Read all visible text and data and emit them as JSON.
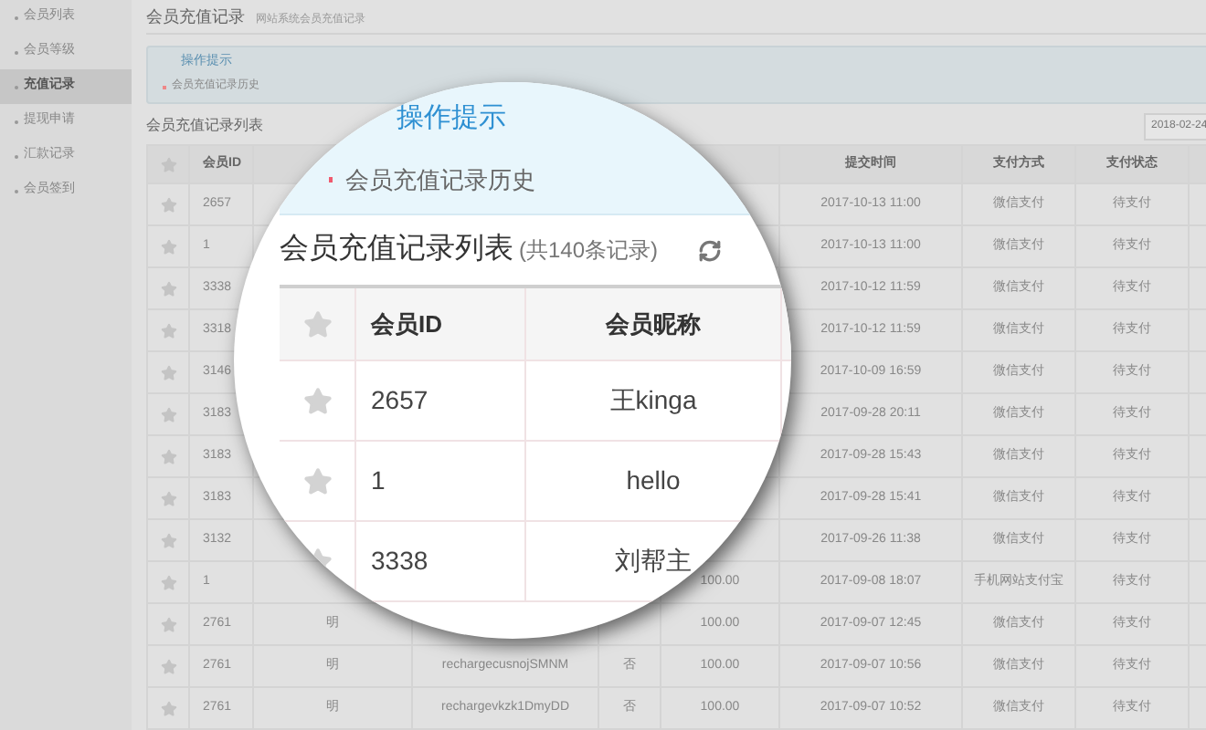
{
  "sidebar": {
    "items": [
      {
        "label": "会员列表",
        "selected": false
      },
      {
        "label": "会员等级",
        "selected": false
      },
      {
        "label": "充值记录",
        "selected": true
      },
      {
        "label": "提现申请",
        "selected": false
      },
      {
        "label": "汇款记录",
        "selected": false
      },
      {
        "label": "会员签到",
        "selected": false
      }
    ]
  },
  "page_header": {
    "title": "会员充值记录",
    "subtitle": "网站系统会员充值记录"
  },
  "tip": {
    "title": "操作提示",
    "item": "会员充值记录历史"
  },
  "list": {
    "title": "会员充值记录列表",
    "date": "2018-02-24"
  },
  "table": {
    "header": {
      "id": "会员ID",
      "time": "提交时间",
      "method": "支付方式",
      "status": "支付状态"
    },
    "rows": [
      {
        "id": "2657",
        "time": "2017-10-13 11:00",
        "method": "微信支付",
        "status": "待支付"
      },
      {
        "id": "1",
        "time": "2017-10-13 11:00",
        "method": "微信支付",
        "status": "待支付"
      },
      {
        "id": "3338",
        "time": "2017-10-12 11:59",
        "method": "微信支付",
        "status": "待支付"
      },
      {
        "id": "3318",
        "time": "2017-10-12 11:59",
        "method": "微信支付",
        "status": "待支付"
      },
      {
        "id": "3146",
        "time": "2017-10-09 16:59",
        "method": "微信支付",
        "status": "待支付"
      },
      {
        "id": "3183",
        "time": "2017-09-28 20:11",
        "method": "微信支付",
        "status": "待支付"
      },
      {
        "id": "3183",
        "time": "2017-09-28 15:43",
        "method": "微信支付",
        "status": "待支付"
      },
      {
        "id": "3183",
        "time": "2017-09-28 15:41",
        "method": "微信支付",
        "status": "待支付"
      },
      {
        "id": "3132",
        "time": "2017-09-26 11:38",
        "method": "微信支付",
        "status": "待支付"
      },
      {
        "id": "1",
        "amount": "100.00",
        "time": "2017-09-08 18:07",
        "method": "手机网站支付宝",
        "status": "待支付"
      },
      {
        "id": "2761",
        "nickname": "明",
        "amount": "100.00",
        "time": "2017-09-07 12:45",
        "method": "微信支付",
        "status": "待支付"
      },
      {
        "id": "2761",
        "nickname": "明",
        "order_no": "rechargecusnojSMNM",
        "flag": "否",
        "amount": "100.00",
        "time": "2017-09-07 10:56",
        "method": "微信支付",
        "status": "待支付"
      },
      {
        "id": "2761",
        "nickname": "明",
        "order_no": "rechargevkzk1DmyDD",
        "flag": "否",
        "amount": "100.00",
        "time": "2017-09-07 10:52",
        "method": "微信支付",
        "status": "待支付"
      }
    ]
  },
  "magnifier": {
    "tip_title": "操作提示",
    "tip_item": "会员充值记录历史",
    "list_title": "会员充值记录列表",
    "list_count": "(共140条记录)",
    "header": {
      "id": "会员ID",
      "nickname": "会员昵称"
    },
    "rows": [
      {
        "id": "2657",
        "nickname": "王kinga"
      },
      {
        "id": "1",
        "nickname": "hello"
      },
      {
        "id": "3338",
        "nickname": "刘帮主"
      }
    ]
  }
}
